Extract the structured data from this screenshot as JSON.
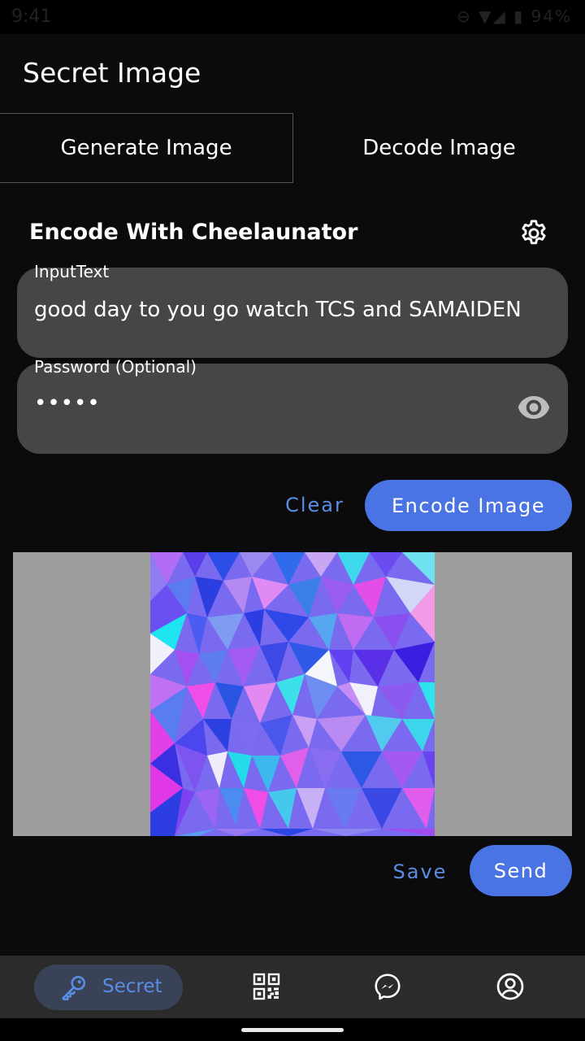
{
  "status_bar": {
    "time": "9:41",
    "icons": "⊖ ▼◢ ▮ 94%"
  },
  "app": {
    "title": "Secret Image"
  },
  "tabs": [
    {
      "label": "Generate Image",
      "selected": true
    },
    {
      "label": "Decode Image",
      "selected": false
    }
  ],
  "encoder": {
    "title": "Encode With Cheelaunator",
    "settings_icon": "gear-icon",
    "input_text": {
      "label": "InputText",
      "value": "good day to you go watch TCS and SAMAIDEN"
    },
    "password": {
      "label": "Password (Optional)",
      "value": "•••••",
      "toggle_icon": "eye-icon"
    },
    "clear_label": "Clear",
    "encode_label": "Encode Image"
  },
  "preview": {
    "save_label": "Save",
    "send_label": "Send"
  },
  "bottom_nav": {
    "items": [
      {
        "label": "Secret",
        "icon": "key-icon",
        "active": true
      },
      {
        "icon": "qr-code-icon"
      },
      {
        "icon": "messenger-icon"
      },
      {
        "icon": "account-circle-icon"
      }
    ]
  },
  "colors": {
    "accent": "#4a74e3",
    "accent_text": "#5a8de6",
    "background": "#0b0b0b",
    "field": "#464646",
    "nav": "#2b2b2b"
  }
}
